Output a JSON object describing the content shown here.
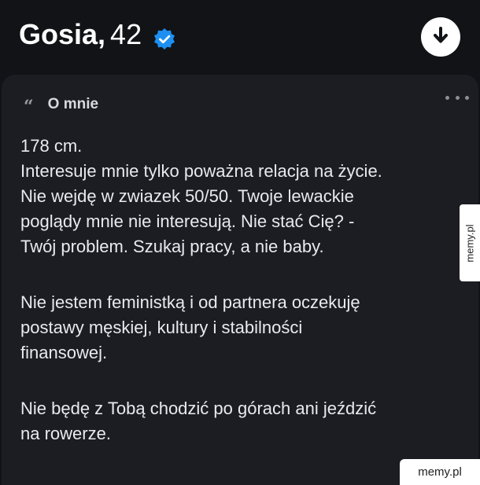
{
  "profile": {
    "name": "Gosia,",
    "age": "42",
    "verified_icon": "verified-badge-icon",
    "download_icon": "arrow-down-icon"
  },
  "about": {
    "quote_icon": "“",
    "heading": "O mnie",
    "more_icon": "more-horizontal-icon",
    "lines": [
      "178 cm.",
      "Interesuje mnie tylko poważna relacja na życie.",
      "Nie wejdę w zwiazek 50/50. Twoje lewackie",
      "poglądy mnie nie interesują. Nie stać Cię? -",
      "Twój problem. Szukaj pracy, a nie baby.",
      "Nie jestem feministką i od partnera oczekuję",
      "postawy męskiej, kultury i stabilności",
      "finansowej.",
      "Nie będę z Tobą chodzić po górach ani jeździć",
      "na rowerze."
    ]
  },
  "watermarks": {
    "side": "memy.pl",
    "corner": "memy.pl"
  },
  "colors": {
    "background": "#111317",
    "card": "#1c1d22",
    "text": "#e9eaef",
    "verified_blue": "#1d8ff2"
  }
}
